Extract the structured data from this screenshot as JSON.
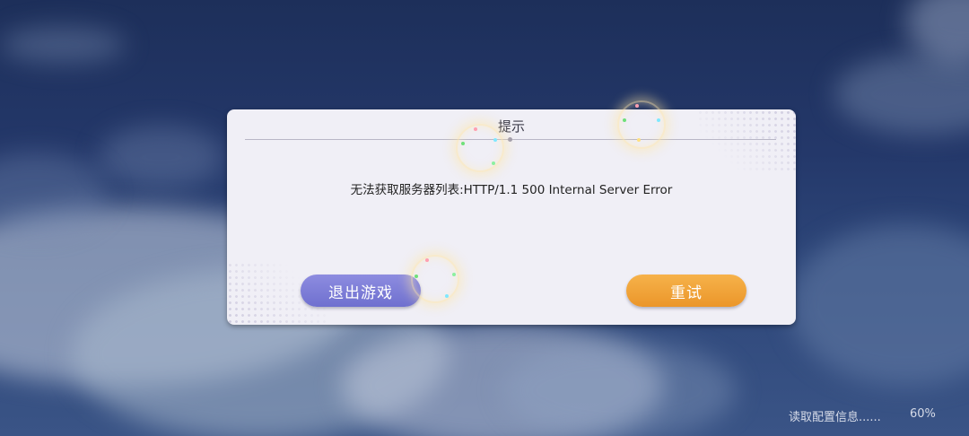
{
  "dialog": {
    "title": "提示",
    "message": "无法获取服务器列表:HTTP/1.1 500 Internal Server Error",
    "exit_label": "退出游戏",
    "retry_label": "重试"
  },
  "loading": {
    "status_text": "读取配置信息......",
    "percent_text": "60%",
    "progress": 0.6
  },
  "icons": [
    "sparkle-effect-icon"
  ],
  "colors": {
    "exit_button": "#7b7bd8",
    "retry_button": "#f0a035",
    "dialog_bg": "#f0eff6"
  }
}
